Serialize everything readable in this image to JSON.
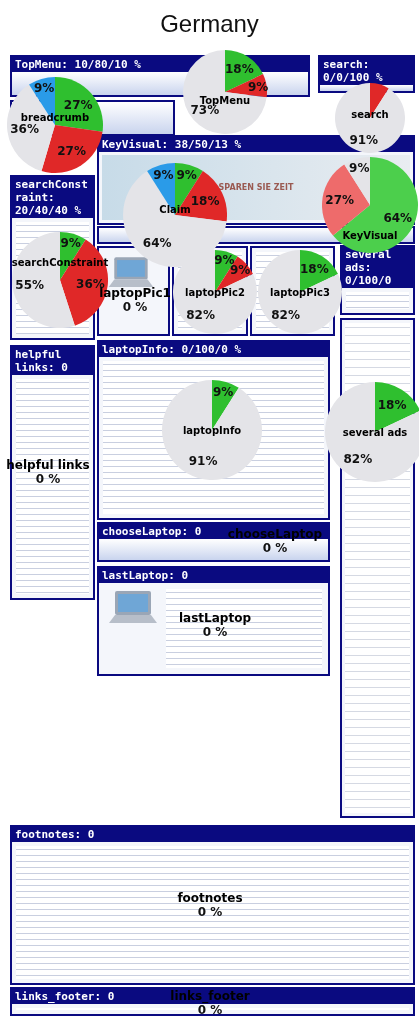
{
  "title": "Germany",
  "regions": [
    {
      "kind": "menu",
      "header": "TopMenu: 10/80/10 %"
    },
    {
      "kind": "menu",
      "header": "search: 0/0/100 %"
    },
    {
      "kind": "menu"
    },
    {
      "kind": "text",
      "header": "searchConstraint: 20/40/40 %"
    },
    {
      "kind": "banner",
      "header": "KeyVisual: 38/50/13 %",
      "banner_text": "SPAREN SIE ZEIT"
    },
    {
      "kind": "menu"
    },
    {
      "kind": "product"
    },
    {
      "kind": "text"
    },
    {
      "kind": "text"
    },
    {
      "kind": "text",
      "header": "several ads: 0/100/0"
    },
    {
      "kind": "text",
      "header": "helpful links: 0"
    },
    {
      "kind": "text",
      "header": "laptopInfo: 0/100/0 %"
    },
    {
      "kind": "menu",
      "header": "chooseLaptop: 0"
    },
    {
      "kind": "product",
      "header": "lastLaptop: 0"
    },
    {
      "kind": "ads"
    },
    {
      "kind": "text",
      "header": "footnotes: 0"
    },
    {
      "kind": "text",
      "header": "links_footer: 0"
    }
  ],
  "gaze": [
    {
      "kind": "pie",
      "name": "breadcrumb",
      "chart_data": {
        "type": "pie",
        "values": [
          27,
          27,
          36,
          9
        ],
        "colors": [
          "#2fbf2f",
          "#e02828",
          "#e4e4e8",
          "#2a9be8"
        ],
        "value_labels": [
          "27%",
          "27%",
          "36%",
          "9%"
        ]
      }
    },
    {
      "kind": "pie",
      "name": "TopMenu",
      "chart_data": {
        "type": "pie",
        "values": [
          18,
          9,
          73
        ],
        "colors": [
          "#2fbf2f",
          "#e02828",
          "#e4e4e8"
        ],
        "value_labels": [
          "18%",
          "9%",
          "73%"
        ]
      }
    },
    {
      "kind": "pie",
      "name": "search",
      "chart_data": {
        "type": "pie",
        "values": [
          9,
          91
        ],
        "colors": [
          "#e02828",
          "#e4e4e8"
        ],
        "value_labels": [
          null,
          "91%"
        ]
      }
    },
    {
      "kind": "pie",
      "name": "KeyVisual",
      "chart_data": {
        "type": "pie",
        "values": [
          64,
          27,
          9
        ],
        "colors": [
          "#4ccf4c",
          "#ee6b6b",
          "#e4e4e8"
        ],
        "value_labels": [
          "64%",
          "27%",
          "9%"
        ]
      }
    },
    {
      "kind": "pie",
      "name": "Claim",
      "chart_data": {
        "type": "pie",
        "values": [
          9,
          18,
          64,
          9
        ],
        "colors": [
          "#2fbf2f",
          "#e02828",
          "#e4e4e8",
          "#2a9be8"
        ],
        "value_labels": [
          "9%",
          "18%",
          "64%",
          "9%"
        ]
      }
    },
    {
      "kind": "pie",
      "name": "searchConstraint",
      "chart_data": {
        "type": "pie",
        "values": [
          9,
          36,
          55
        ],
        "colors": [
          "#2fbf2f",
          "#e02828",
          "#e4e4e8"
        ],
        "value_labels": [
          "9%",
          "36%",
          "55%"
        ]
      }
    },
    {
      "kind": "zero",
      "name": "laptopPic1",
      "share": "0 %"
    },
    {
      "kind": "pie",
      "name": "laptopPic2",
      "chart_data": {
        "type": "pie",
        "values": [
          9,
          9,
          82
        ],
        "colors": [
          "#2fbf2f",
          "#e02828",
          "#e4e4e8"
        ],
        "value_labels": [
          "9%",
          "9%",
          "82%"
        ]
      }
    },
    {
      "kind": "pie",
      "name": "laptopPic3",
      "chart_data": {
        "type": "pie",
        "values": [
          18,
          82
        ],
        "colors": [
          "#2fbf2f",
          "#e4e4e8"
        ],
        "value_labels": [
          "18%",
          "82%"
        ]
      }
    },
    {
      "kind": "pie",
      "name": "laptopInfo",
      "chart_data": {
        "type": "pie",
        "values": [
          9,
          91
        ],
        "colors": [
          "#2fbf2f",
          "#e4e4e8"
        ],
        "value_labels": [
          "9%",
          "91%"
        ]
      }
    },
    {
      "kind": "pie",
      "name": "several ads",
      "chart_data": {
        "type": "pie",
        "values": [
          18,
          82
        ],
        "colors": [
          "#2fbf2f",
          "#e4e4e8"
        ],
        "value_labels": [
          "18%",
          "82%"
        ]
      }
    },
    {
      "kind": "zero",
      "name": "helpful links",
      "share": "0 %"
    },
    {
      "kind": "zero",
      "name": "chooseLaptop",
      "share": "0 %"
    },
    {
      "kind": "zero",
      "name": "lastLaptop",
      "share": "0 %"
    },
    {
      "kind": "zero",
      "name": "footnotes",
      "share": "0 %"
    },
    {
      "kind": "zero",
      "name": "links_footer",
      "share": "0 %"
    }
  ]
}
